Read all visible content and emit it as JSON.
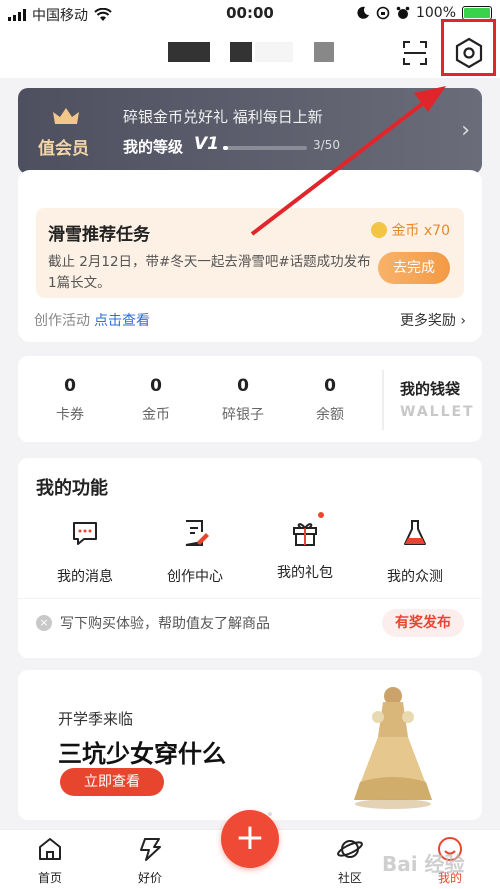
{
  "status_bar": {
    "carrier": "中国移动",
    "time": "00:00",
    "battery": "100%"
  },
  "vip": {
    "title": "值会员",
    "promo": "碎银金币兑好礼 福利每日上新",
    "level_label": "我的等级",
    "level": "V1",
    "progress_text": "3/50",
    "progress": 0.06
  },
  "task": {
    "title": "滑雪推荐任务",
    "reward": "金币 x70",
    "description": "截止 2月12日，带#冬天一起去滑雪吧#话题成功发布1篇长文。",
    "button": "去完成",
    "creation_label": "创作活动",
    "creation_link": "点击查看",
    "more_rewards": "更多奖励 ›"
  },
  "wallet": {
    "stats": [
      {
        "value": "0",
        "label": "卡券"
      },
      {
        "value": "0",
        "label": "金币"
      },
      {
        "value": "0",
        "label": "碎银子"
      },
      {
        "value": "0",
        "label": "余额"
      }
    ],
    "title": "我的钱袋",
    "subtitle": "WALLET"
  },
  "features": {
    "title": "我的功能",
    "items": [
      {
        "label": "我的消息",
        "icon": "message-icon"
      },
      {
        "label": "创作中心",
        "icon": "creation-icon"
      },
      {
        "label": "我的礼包",
        "icon": "gift-icon"
      },
      {
        "label": "我的众测",
        "icon": "flask-icon"
      }
    ],
    "tip_text": "写下购买体验，帮助值友了解商品",
    "tip_button": "有奖发布"
  },
  "banner": {
    "subtitle": "开学季来临",
    "title": "三坑少女穿什么",
    "button": "立即查看"
  },
  "tabs": [
    {
      "label": "首页",
      "icon": "home-icon"
    },
    {
      "label": "好价",
      "icon": "deal-icon"
    },
    {
      "label": "+",
      "icon": "plus-icon"
    },
    {
      "label": "社区",
      "icon": "planet-icon"
    },
    {
      "label": "我的",
      "icon": "profile-icon"
    }
  ],
  "watermark": "Bai 经验",
  "colors": {
    "accent": "#e8452f",
    "annotation": "#e0262b",
    "vip_bg": "#4e5060",
    "link": "#2f6fd6"
  }
}
